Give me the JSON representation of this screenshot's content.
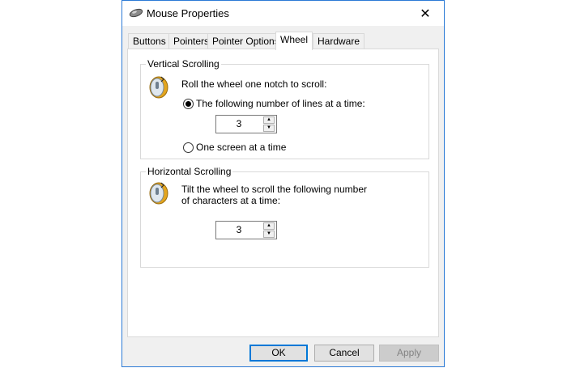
{
  "window": {
    "title": "Mouse Properties",
    "close_glyph": "✕"
  },
  "tabs": [
    {
      "label": "Buttons",
      "active": false
    },
    {
      "label": "Pointers",
      "active": false
    },
    {
      "label": "Pointer Options",
      "active": false
    },
    {
      "label": "Wheel",
      "active": true
    },
    {
      "label": "Hardware",
      "active": false
    }
  ],
  "vertical": {
    "group_label": "Vertical Scrolling",
    "instruction": "Roll the wheel one notch to scroll:",
    "option_lines_label": "The following number of lines at a time:",
    "option_lines_selected": true,
    "lines_value": "3",
    "option_screen_label": "One screen at a time",
    "option_screen_selected": false
  },
  "horizontal": {
    "group_label": "Horizontal Scrolling",
    "instruction_line1": "Tilt the wheel to scroll the following number",
    "instruction_line2": "of characters at a time:",
    "chars_value": "3"
  },
  "buttons": {
    "ok": "OK",
    "cancel": "Cancel",
    "apply": "Apply"
  },
  "icons": {
    "window": "mouse-icon",
    "wheel": "mouse-wheel-icon"
  },
  "colors": {
    "accent": "#0078d7",
    "window_border": "#2b7ad6"
  }
}
